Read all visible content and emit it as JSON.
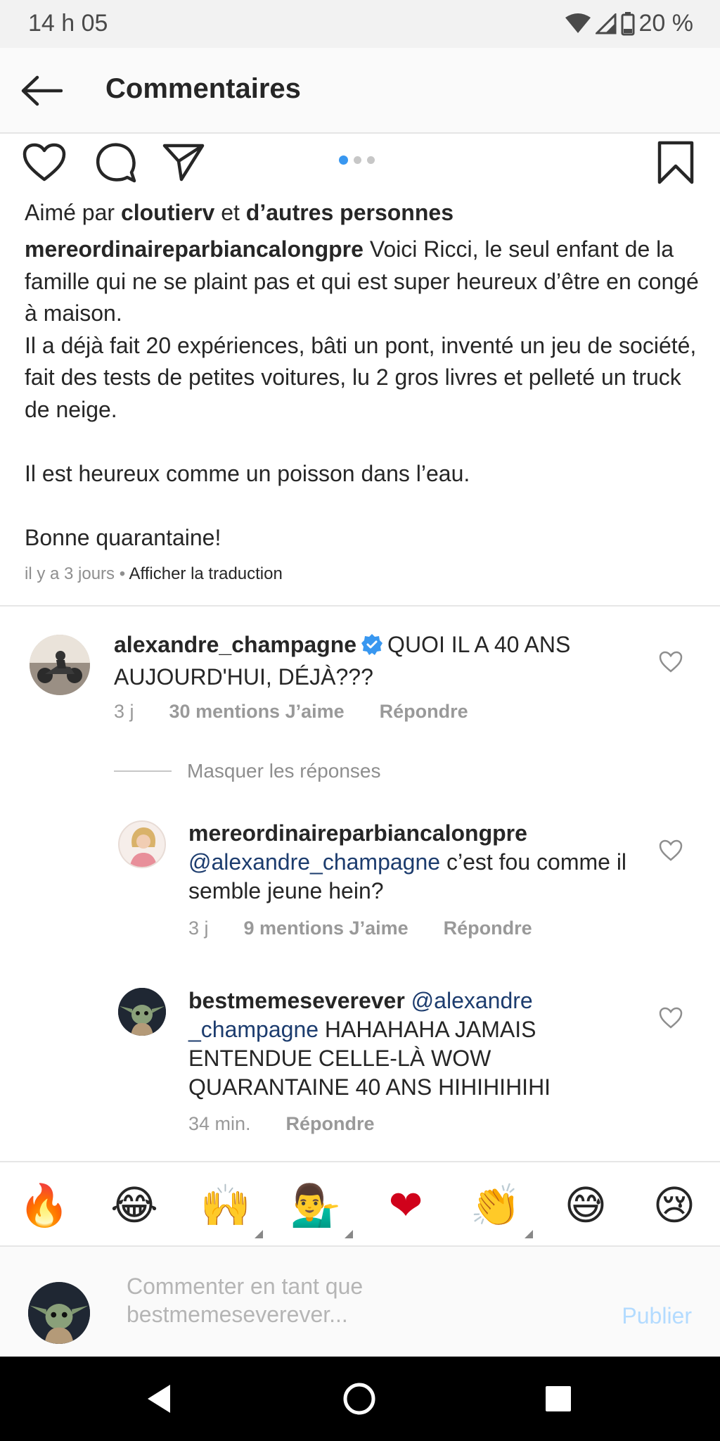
{
  "status_bar": {
    "time": "14 h 05",
    "battery": "20 %"
  },
  "header": {
    "title": "Commentaires"
  },
  "post": {
    "liked_by_prefix": "Aimé par",
    "liked_by_user": "cloutierv",
    "liked_by_and": "et",
    "liked_by_others": "d’autres personnes",
    "caption_user": "mereordinaireparbiancalongpre",
    "caption_lines": [
      " Voici Ricci, le seul enfant de la famille qui ne se plaint pas et qui est super heureux d’être en congé à maison.",
      "Il a déjà fait 20 expériences, bâti un pont, inventé un jeu de société, fait des tests de petites voitures, lu 2 gros livres et pelleté un truck de neige.",
      "Il est heureux comme un poisson dans l’eau.",
      "Bonne quarantaine!"
    ],
    "time_ago": "il y a 3 jours",
    "separator": " • ",
    "translate": "Afficher la traduction",
    "carousel": {
      "total": 3,
      "active": 1
    }
  },
  "comments": [
    {
      "user": "alexandre_champagne",
      "verified": true,
      "text": "QUOI IL A 40 ANS AUJOURD'HUI, DÉJÀ???",
      "time": "3 j",
      "likes": "30 mentions J’aime",
      "reply": "Répondre"
    }
  ],
  "hide_replies": "Masquer les réponses",
  "replies": [
    {
      "user": "mereordinaireparbiancalongpre",
      "mention": "@alexandre_champagne",
      "text": " c’est fou comme il semble jeune hein?",
      "time": "3 j",
      "likes": "9 mentions J’aime",
      "reply": "Répondre"
    },
    {
      "user": "bestmemeseverever",
      "mention_part1": "@alexandre",
      "mention_part2": "_champagne",
      "text": " HAHAHAHA JAMAIS ENTENDUE CELLE-LÀ WOW QUARANTAINE 40 ANS HIHIHIHIHI",
      "time": "34 min.",
      "reply": "Répondre"
    }
  ],
  "emojis": [
    {
      "glyph": "🔥",
      "name": "fire-emoji",
      "variants": false
    },
    {
      "glyph": "😂",
      "name": "tears-of-joy-emoji",
      "variants": false
    },
    {
      "glyph": "🙌",
      "name": "raising-hands-emoji",
      "variants": true
    },
    {
      "glyph": "💁‍♂️",
      "name": "info-desk-man-emoji",
      "variants": true
    },
    {
      "glyph": "❤",
      "name": "red-heart-emoji",
      "variants": false
    },
    {
      "glyph": "👏",
      "name": "clapping-hands-emoji",
      "variants": true
    },
    {
      "glyph": "😅",
      "name": "sweat-smile-emoji",
      "variants": false
    },
    {
      "glyph": "😢",
      "name": "crying-face-emoji",
      "variants": false
    }
  ],
  "compose": {
    "placeholder_line1": "Commenter en tant que",
    "placeholder_line2": "bestmemeseverever...",
    "publish": "Publier"
  },
  "colors": {
    "accent": "#3897f0",
    "mention": "#1c3c6e",
    "publish_disabled": "#b3dbff",
    "meta_gray": "#8e8e8e"
  }
}
